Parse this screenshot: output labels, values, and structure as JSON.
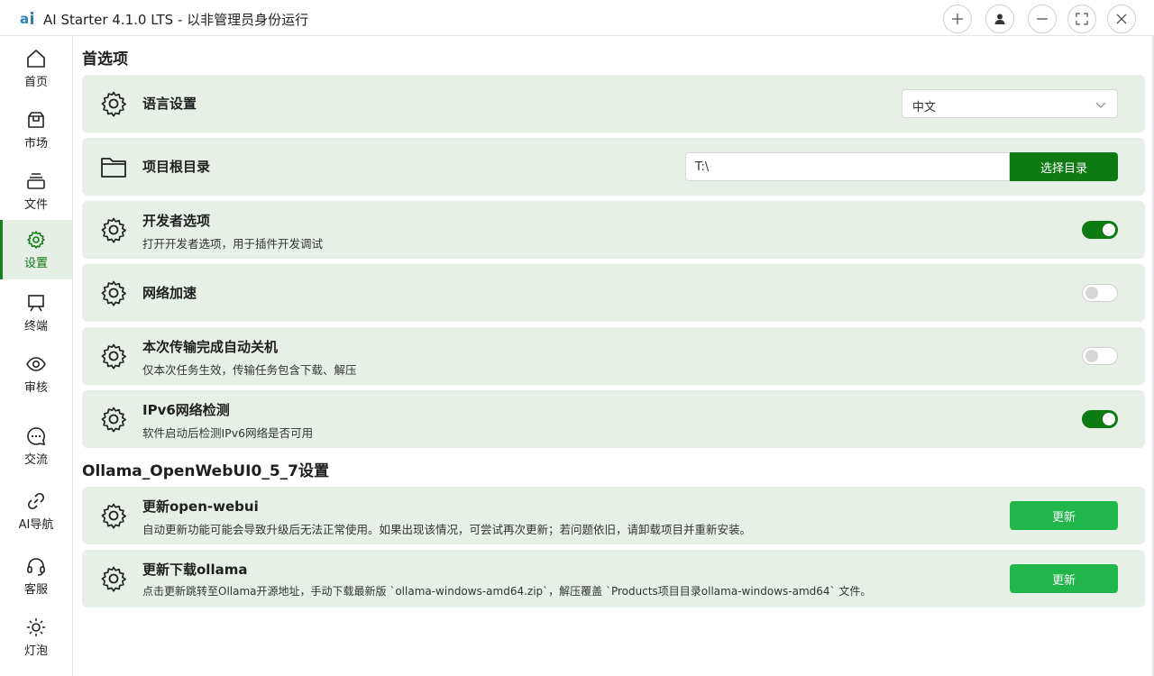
{
  "window": {
    "title": "AI Starter 4.1.0 LTS - 以非管理员身份运行"
  },
  "sidebar": {
    "items": [
      {
        "label": "首页",
        "icon": "home-icon"
      },
      {
        "label": "市场",
        "icon": "store-icon"
      },
      {
        "label": "文件",
        "icon": "files-icon"
      },
      {
        "label": "设置",
        "icon": "settings-icon",
        "active": true
      },
      {
        "label": "终端",
        "icon": "terminal-icon"
      },
      {
        "label": "审核",
        "icon": "eye-icon"
      },
      {
        "label": "交流",
        "icon": "chat-icon"
      },
      {
        "label": "AI导航",
        "icon": "link-icon"
      },
      {
        "label": "客服",
        "icon": "headset-icon"
      },
      {
        "label": "灯泡",
        "icon": "bulb-icon"
      }
    ]
  },
  "preferences": {
    "section_title": "首选项",
    "language": {
      "title": "语言设置",
      "value": "中文"
    },
    "root_dir": {
      "title": "项目根目录",
      "path": "T:\\",
      "button": "选择目录"
    },
    "developer": {
      "title": "开发者选项",
      "desc": "打开开发者选项，用于插件开发调试",
      "enabled": true
    },
    "network_accel": {
      "title": "网络加速",
      "enabled": false
    },
    "auto_shutdown": {
      "title": "本次传输完成自动关机",
      "desc": "仅本次任务生效，传输任务包含下载、解压",
      "enabled": false
    },
    "ipv6": {
      "title": "IPv6网络检测",
      "desc": "软件启动后检测IPv6网络是否可用",
      "enabled": true
    }
  },
  "project": {
    "section_title": "Ollama_OpenWebUI0_5_7设置",
    "update_webui": {
      "title": "更新open-webui",
      "desc": "自动更新功能可能会导致升级后无法正常使用。如果出现该情况，可尝试再次更新；若问题依旧，请卸载项目并重新安装。",
      "button": "更新"
    },
    "update_ollama": {
      "title": "更新下载ollama",
      "desc": "点击更新跳转至Ollama开源地址，手动下载最新版 `ollama-windows-amd64.zip`，解压覆盖 `Products项目目录ollama-windows-amd64` 文件。",
      "button": "更新"
    }
  },
  "colors": {
    "accent_dark": "#0e7a12",
    "accent_green": "#21b64a",
    "card_bg": "#e6f0e6"
  }
}
